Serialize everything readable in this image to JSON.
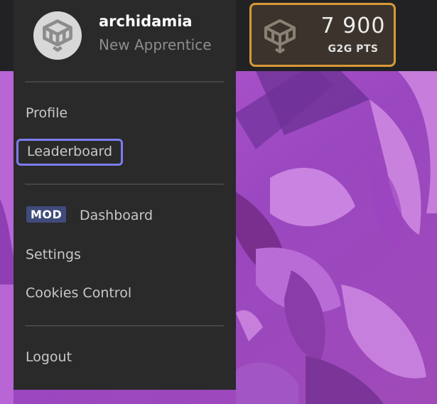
{
  "user": {
    "username": "archidamia",
    "rank": "New Apprentice",
    "avatar_icon": "g2g-logo-icon"
  },
  "points": {
    "value": "7 900",
    "label": "G2G PTS",
    "icon": "g2g-logo-icon",
    "border_color": "#d79a35"
  },
  "menu": {
    "profile": "Profile",
    "leaderboard": "Leaderboard",
    "mod_badge": "MOD",
    "dashboard": "Dashboard",
    "settings": "Settings",
    "cookies": "Cookies Control",
    "logout": "Logout"
  },
  "colors": {
    "panel": "#2a2a2a",
    "focus_ring": "#7c7cf0",
    "mod_badge": "#3f4b7a",
    "background_art": "#a24fc4"
  }
}
